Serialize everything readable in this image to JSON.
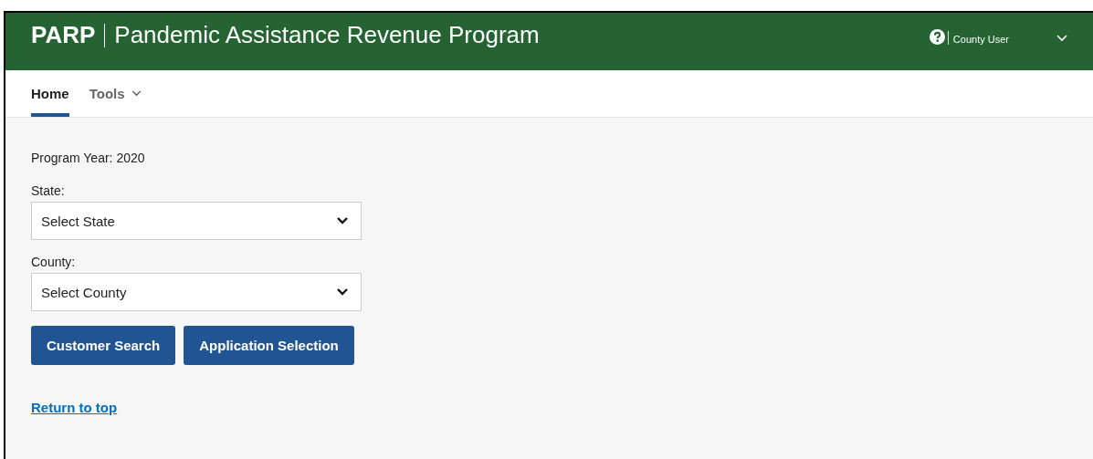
{
  "header": {
    "brand": "PARP",
    "title": "Pandemic Assistance Revenue Program",
    "user": "County User"
  },
  "nav": {
    "tabs": [
      {
        "label": "Home",
        "selected": true,
        "has_menu": false
      },
      {
        "label": "Tools",
        "selected": false,
        "has_menu": true
      }
    ]
  },
  "program_year": "Program Year: 2020",
  "fields": [
    {
      "label": "State:",
      "value": "Select State"
    },
    {
      "label": "County:",
      "value": "Select County"
    }
  ],
  "buttons": [
    "Customer Search",
    "Application Selection"
  ],
  "return_link": "Return to top"
}
